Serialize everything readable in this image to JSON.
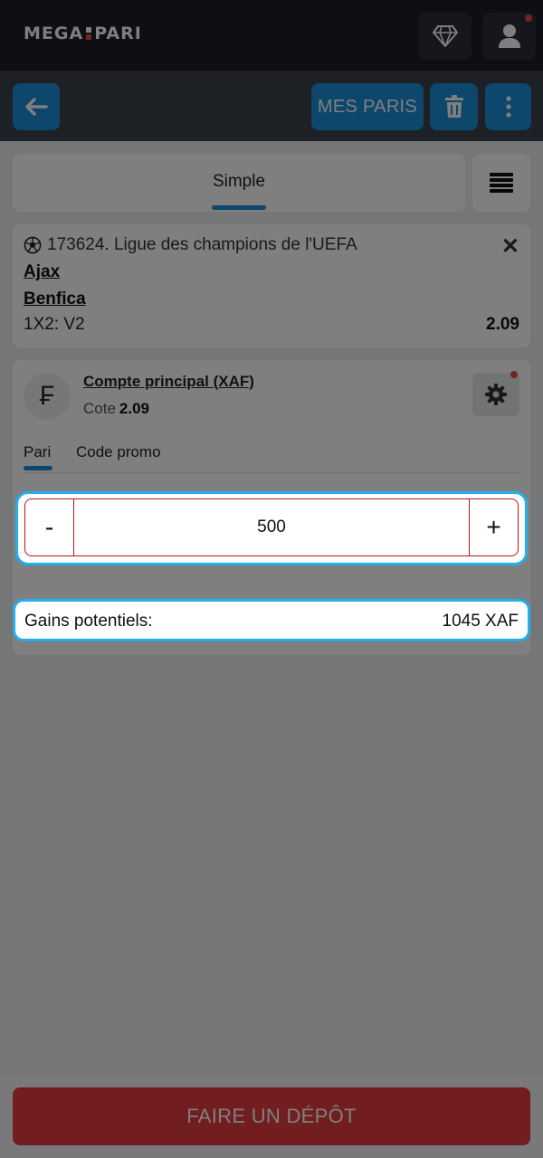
{
  "brand": {
    "logo_left": "MEGA",
    "logo_right": "PARI"
  },
  "header": {
    "vip_icon": "diamond-icon",
    "profile_icon": "user-icon"
  },
  "actions": {
    "back_icon": "arrow-left-icon",
    "my_bets": "MES PARIS",
    "trash_icon": "trash-icon",
    "more_icon": "more-vertical-icon"
  },
  "tabs": {
    "active": "Simple",
    "menu_icon": "hamburger-icon"
  },
  "bet": {
    "league": "173624. Ligue des champions de l'UEFA",
    "team_home": "Ajax",
    "team_away": "Benfica",
    "market": "1X2: V2",
    "odd": "2.09",
    "sport_icon": "soccer-ball-icon"
  },
  "account": {
    "currency_symbol": "₣",
    "name": "Compte principal (XAF)",
    "cote_label": "Cote",
    "cote_value": "2.09"
  },
  "subtabs": {
    "bet": "Pari",
    "promo": "Code promo"
  },
  "stake": {
    "minus": "-",
    "value": "500",
    "plus": "+"
  },
  "gains": {
    "label": "Gains potentiels:",
    "value": "1045 XAF"
  },
  "footer": {
    "deposit": "FAIRE UN DÉPÔT"
  },
  "colors": {
    "accent": "#1a8fd6",
    "highlight": "#20b0ee",
    "deposit": "#e53a3e",
    "topbar": "#1f1f26"
  }
}
